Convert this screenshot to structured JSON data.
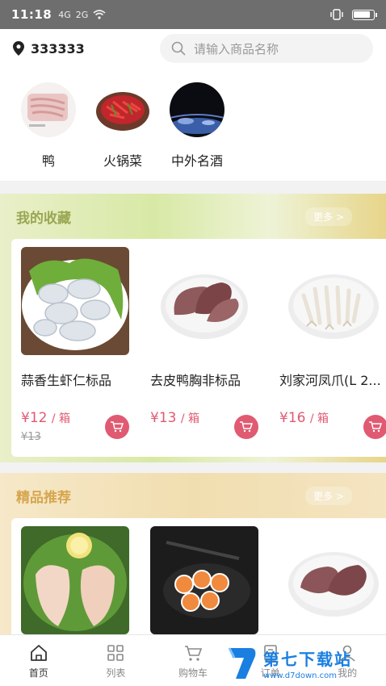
{
  "status_bar": {
    "time": "11:18",
    "signal_labels": [
      "4G",
      "2G"
    ],
    "battery_level": 0.9
  },
  "header": {
    "location": "333333",
    "search_placeholder": "请输入商品名称"
  },
  "categories": [
    {
      "label": "鸭",
      "image": "duck-feet-image"
    },
    {
      "label": "火锅菜",
      "image": "hotpot-dish-image"
    },
    {
      "label": "中外名酒",
      "image": "liquor-image"
    }
  ],
  "favorites": {
    "title": "我的收藏",
    "more": "更多 >",
    "products": [
      {
        "name": "蒜香生虾仁标品",
        "price": "¥12",
        "unit": "/ 箱",
        "old_price": "¥13",
        "image": "shrimp-image"
      },
      {
        "name": "去皮鸭胸非标品",
        "price": "¥13",
        "unit": "/ 箱",
        "old_price": "",
        "image": "duck-breast-image"
      },
      {
        "name": "刘家河凤爪(L 2...",
        "price": "¥16",
        "unit": "/ 箱",
        "old_price": "",
        "image": "chicken-feet-image"
      }
    ]
  },
  "featured": {
    "title": "精品推荐",
    "more": "更多 >",
    "products": [
      {
        "image": "chicken-breast-image"
      },
      {
        "image": "salmon-roll-image"
      },
      {
        "image": "duck-meat-image"
      }
    ]
  },
  "tabbar": [
    {
      "label": "首页",
      "icon": "home-icon",
      "active": true
    },
    {
      "label": "列表",
      "icon": "grid-icon",
      "active": false
    },
    {
      "label": "购物车",
      "icon": "cart-icon",
      "active": false
    },
    {
      "label": "订单",
      "icon": "order-icon",
      "active": false
    },
    {
      "label": "我的",
      "icon": "user-icon",
      "active": false
    }
  ],
  "watermark": {
    "main": "第七下载站",
    "sub": "www.d7down.com"
  },
  "colors": {
    "accent": "#e05a72",
    "favorites_title": "#9aa653",
    "featured_title": "#d6a64e",
    "watermark": "#1a7fe0"
  }
}
